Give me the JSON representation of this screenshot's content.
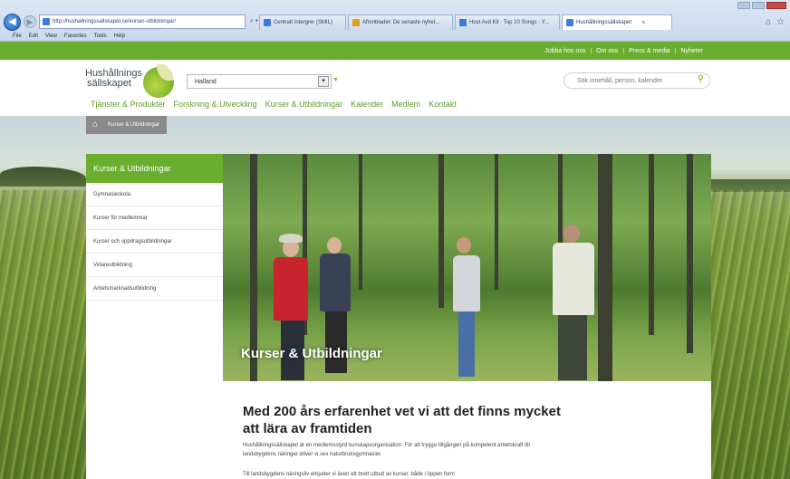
{
  "browser": {
    "url": "http://hushallningssallskapet.se/kurser-utbildningar/",
    "tabs": [
      {
        "label": "Centralt Intergrer (SMIL)",
        "color": "#3b7bd9"
      },
      {
        "label": "Aftonbladet: De senaste nyhet...",
        "color": "#d8a01c"
      },
      {
        "label": "Host Avd Kit · Top 10 Songs · Y...",
        "color": "#3b7bd9"
      },
      {
        "label": "Hushållningssällskapet",
        "color": "#3b7bd9",
        "active": true
      }
    ],
    "menu": [
      "File",
      "Edit",
      "View",
      "Favorites",
      "Tools",
      "Help"
    ]
  },
  "toplinks": [
    "Jobba hos oss",
    "Om oss",
    "Press & media",
    "Nyheter"
  ],
  "logo": {
    "line1": "Hushållnings",
    "line2": "sällskapet"
  },
  "region": {
    "value": "Halland"
  },
  "search": {
    "placeholder": "Sök innehåll, person, kalender"
  },
  "mainnav": [
    "Tjänster & Produkter",
    "Forskning & Utveckling",
    "Kurser & Utbildningar",
    "Kalender",
    "Medlem",
    "Kontakt"
  ],
  "breadcrumb": {
    "current": "Kurser & Utbildningar"
  },
  "sidebar": {
    "title": "Kurser & Utbildningar",
    "items": [
      "Gymnasieskola",
      "Kurser för medlemmar",
      "Kurser och uppdragsutbildningar",
      "Vidareutbildning",
      "Arbetsmarknadsutbildning"
    ]
  },
  "hero": {
    "title": "Kurser & Utbildningar"
  },
  "content": {
    "heading": "Med 200 års erfarenhet vet vi att det finns mycket att lära av framtiden",
    "p1": "Hushållningssällskapet är en medlemsstyrd kunskapsorganisation. För att trygga tillgången på kompetent arbetskraft till landsbygdens näringar driver vi sex naturbruksgymnasier.",
    "p2": "Till landsbygdens näringsliv erbjuder vi även ett brett utbud av kurser, både i öppen form"
  },
  "colors": {
    "green": "#6aae2f",
    "navgreen": "#5a9d26"
  }
}
